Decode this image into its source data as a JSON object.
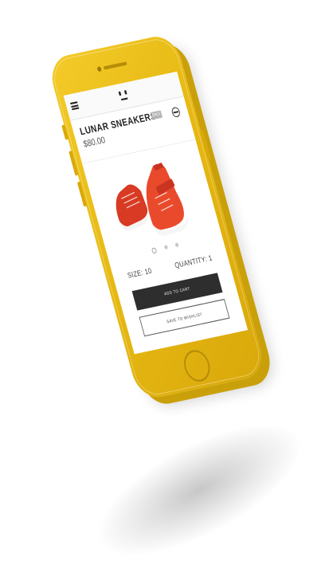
{
  "app": {
    "menu_icon": "hamburger-menu-icon",
    "logo_icon": "smiley-face-logo-icon",
    "share_icon": "circle-share-icon"
  },
  "product": {
    "title": "LUNAR SNEAKERS",
    "price": "$80.00",
    "badge": "SALE",
    "image_alt": "orange high-top sneakers",
    "carousel": {
      "count": 3,
      "active_index": 0
    }
  },
  "options": {
    "size_label": "SIZE: 10",
    "quantity_label": "QUANTITY: 1"
  },
  "actions": {
    "add_to_cart": "ADD TO CART",
    "save_to_wishlist": "SAVE TO WISHLIST"
  },
  "colors": {
    "phone_body": "#e7b913",
    "shoe": "#e8432a",
    "cart_button": "#2e2e2e"
  }
}
